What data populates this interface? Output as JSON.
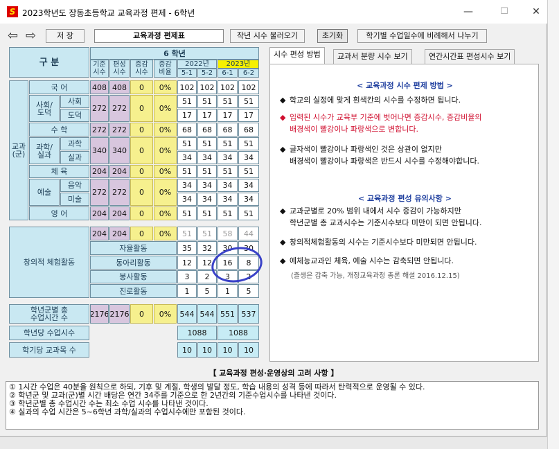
{
  "window": {
    "title": "2023학년도 장동초등학교 교육과정 편제 - 6학년",
    "minimize": "—",
    "maximize": "☐",
    "close": "✕"
  },
  "toolbar": {
    "back": "⇦",
    "forward": "⇨",
    "save": "저 장",
    "table_title": "교육과정 편제표",
    "load_prev": "작년 시수 불러오기",
    "reset": "초기화",
    "split": "학기별 수업일수에 비례해서 나누기"
  },
  "grid": {
    "header_gubun": "구 분",
    "header_grade": "6 학년",
    "col_base": "기준\n시수",
    "col_plan": "편성\n시수",
    "col_diff": "증감\n시수",
    "col_rate": "증감\n비율",
    "year_2022": "2022년",
    "year_2023": "2023년",
    "sem": [
      "5-1",
      "5-2",
      "6-1",
      "6-2"
    ],
    "group_subjects": "교과\n(군)",
    "subjects": {
      "korean": "국 어",
      "social_moral": "사회/\n도덕",
      "social": "사회",
      "moral": "도덕",
      "math": "수 학",
      "sci_practical": "과학/\n실과",
      "science": "과학",
      "practical": "실과",
      "pe": "체 육",
      "arts": "예술",
      "music": "음악",
      "art": "미술",
      "english": "영 어"
    },
    "rows": {
      "korean": {
        "base": "408",
        "plan": "408",
        "diff": "0",
        "rate": "0%",
        "s": [
          "102",
          "102",
          "102",
          "102"
        ]
      },
      "social_moral": {
        "base": "272",
        "plan": "272",
        "diff": "0",
        "rate": "0%"
      },
      "social": {
        "s": [
          "51",
          "51",
          "51",
          "51"
        ]
      },
      "moral": {
        "s": [
          "17",
          "17",
          "17",
          "17"
        ]
      },
      "math": {
        "base": "272",
        "plan": "272",
        "diff": "0",
        "rate": "0%",
        "s": [
          "68",
          "68",
          "68",
          "68"
        ]
      },
      "sci_practical": {
        "base": "340",
        "plan": "340",
        "diff": "0",
        "rate": "0%"
      },
      "science": {
        "s": [
          "51",
          "51",
          "51",
          "51"
        ]
      },
      "practical": {
        "s": [
          "34",
          "34",
          "34",
          "34"
        ]
      },
      "pe": {
        "base": "204",
        "plan": "204",
        "diff": "0",
        "rate": "0%",
        "s": [
          "51",
          "51",
          "51",
          "51"
        ]
      },
      "arts": {
        "base": "272",
        "plan": "272",
        "diff": "0",
        "rate": "0%"
      },
      "music": {
        "s": [
          "34",
          "34",
          "34",
          "34"
        ]
      },
      "art": {
        "s": [
          "34",
          "34",
          "34",
          "34"
        ]
      },
      "english": {
        "base": "204",
        "plan": "204",
        "diff": "0",
        "rate": "0%",
        "s": [
          "51",
          "51",
          "51",
          "51"
        ]
      }
    },
    "creative": {
      "label": "창의적 체험활동",
      "base": "204",
      "plan": "204",
      "diff": "0",
      "rate": "0%",
      "s": [
        "51",
        "51",
        "58",
        "44"
      ],
      "acts": [
        {
          "name": "자율활동",
          "s": [
            "35",
            "32",
            "30",
            "30"
          ]
        },
        {
          "name": "동아리활동",
          "s": [
            "12",
            "12",
            "16",
            "8"
          ]
        },
        {
          "name": "봉사활동",
          "s": [
            "3",
            "2",
            "3",
            "2"
          ]
        },
        {
          "name": "진로활동",
          "s": [
            "1",
            "5",
            "1",
            "5"
          ]
        }
      ]
    },
    "total": {
      "label": "학년군별 총\n수업시간 수",
      "base": "2176",
      "plan": "2176",
      "diff": "0",
      "rate": "0%",
      "s": [
        "544",
        "544",
        "551",
        "537"
      ]
    },
    "per_year": {
      "label": "학년당 수업시수",
      "y2022": "1088",
      "y2023": "1088"
    },
    "per_sem": {
      "label": "학기당 교과목 수",
      "s": [
        "10",
        "10",
        "10",
        "10"
      ]
    }
  },
  "tabs": [
    {
      "label": "시수 편성 방법"
    },
    {
      "label": "교과서 분량 시수 보기"
    },
    {
      "label": "연간시간표 편성시수 보기"
    }
  ],
  "panel": {
    "heading1": "< 교육과정 시수 편제 방법 >",
    "b1": "학교의 실정에 맞게 흰색칸의 시수를 수정하면 됩니다.",
    "b2a": "입력된 시수가 교육부 기준에 벗어나면 증감시수, 증감비율의",
    "b2b": "배경색이 빨강이나 파랑색으로 변합니다.",
    "b3a": "글자색이 빨강이나 파랑색인 것은 상관이 없지만",
    "b3b": "배경색이 빨강이나 파랑색은 반드시 시수를 수정해야합니다.",
    "heading2": "< 교육과정 편성 유의사항 >",
    "c1a": "교과군별로 20% 범위 내에서 시수 증감이 가능하지만",
    "c1b": "학년군별 총 교과시수는 기준시수보다 미만이 되면 안됩니다.",
    "c2": "창의적체험활동의 시수는 기준시수보다 미만되면 안됩니다.",
    "c3": "예체능교과인 체육, 예술 시수는 감축되면 안됩니다.",
    "c3note": "(즐생은 감축 가능, 개정교육과정 총론 해설 2016.12.15)",
    "bullet": "◆"
  },
  "considerations": {
    "title": "【 교육과정 편성·운영상의 고려 사항 】",
    "lines": [
      "① 1시간 수업은 40분을 원칙으로 하되, 기후 및 계절, 학생의 발달 정도, 학습 내용의 성격 등에 따라서 탄력적으로 운영될 수 있다.",
      "② 학년군 및 교과(군)별 시간 배당은 연간 34주를 기준으로 한 2년간의 기준수업시수를 나타낸 것이다.",
      "③ 학년군별 총 수업시간 수는 최소 수업 시수를 나타낸 것이다.",
      "④ 실과의 수업 시간은 5~6학년 과학/실과의 수업시수에만 포함된 것이다."
    ]
  }
}
